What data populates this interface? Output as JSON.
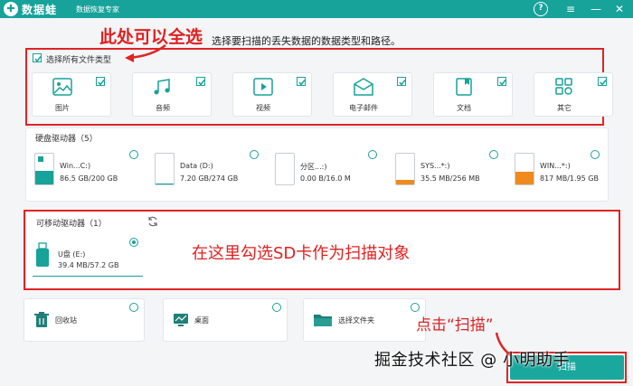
{
  "window": {
    "app_name": "数据蛙",
    "app_subtitle": "数据恢复专家",
    "help_glyph": "?",
    "menu_glyph": "≡",
    "minimize_glyph": "—",
    "close_glyph": "✕",
    "brand_color": "#17a29a"
  },
  "annotations": {
    "select_all_hint": "此处可以全选",
    "sd_card_hint": "在这里勾选SD卡作为扫描对象",
    "click_scan_hint": "点击“扫描”",
    "accent_color": "#e02424"
  },
  "instruction": "选择要扫描的丢失数据的数据类型和路径。",
  "file_types": {
    "select_all_label": "选择所有文件类型",
    "select_all_checked": true,
    "items": [
      {
        "label": "图片",
        "icon": "image-icon",
        "checked": true
      },
      {
        "label": "音频",
        "icon": "music-icon",
        "checked": true
      },
      {
        "label": "视频",
        "icon": "video-icon",
        "checked": true
      },
      {
        "label": "电子邮件",
        "icon": "mail-icon",
        "checked": true
      },
      {
        "label": "文档",
        "icon": "document-icon",
        "checked": true
      },
      {
        "label": "其它",
        "icon": "other-icon",
        "checked": true
      }
    ]
  },
  "hard_drives": {
    "title": "硬盘驱动器（5）",
    "items": [
      {
        "name": "Win...C:)",
        "size": "86.5 GB/200 GB",
        "used_fraction": 0.43,
        "fill_color": "#17a29a",
        "icon": "windows-drive-icon"
      },
      {
        "name": "Data (D:)",
        "size": "7.20 GB/274 GB",
        "used_fraction": 0.03,
        "fill_color": "#17a29a",
        "icon": "drive-icon"
      },
      {
        "name": "分区...:)",
        "size": "0.00  B/16.0 M",
        "used_fraction": 0.0,
        "fill_color": "#17a29a",
        "icon": "drive-icon"
      },
      {
        "name": "SYS...*:)",
        "size": "35.5 MB/256 MB",
        "used_fraction": 0.14,
        "fill_color": "#f08a1c",
        "icon": "drive-icon"
      },
      {
        "name": "WIN...*:)",
        "size": "817 MB/1.95 GB",
        "used_fraction": 0.42,
        "fill_color": "#f08a1c",
        "icon": "drive-icon"
      }
    ]
  },
  "removable_drives": {
    "title": "可移动驱动器（1）",
    "refresh_icon": "refresh-icon",
    "items": [
      {
        "name": "U盘 (E:)",
        "size": "39.4 MB/57.2 GB",
        "selected": true,
        "icon": "usb-drive-icon"
      }
    ]
  },
  "locations": [
    {
      "label": "回收站",
      "icon": "recycle-bin-icon"
    },
    {
      "label": "桌面",
      "icon": "desktop-icon"
    },
    {
      "label": "选择文件夹",
      "icon": "folder-icon"
    }
  ],
  "scan_button": {
    "label": "扫描"
  },
  "watermark": "掘金技术社区 @ 小明助手"
}
